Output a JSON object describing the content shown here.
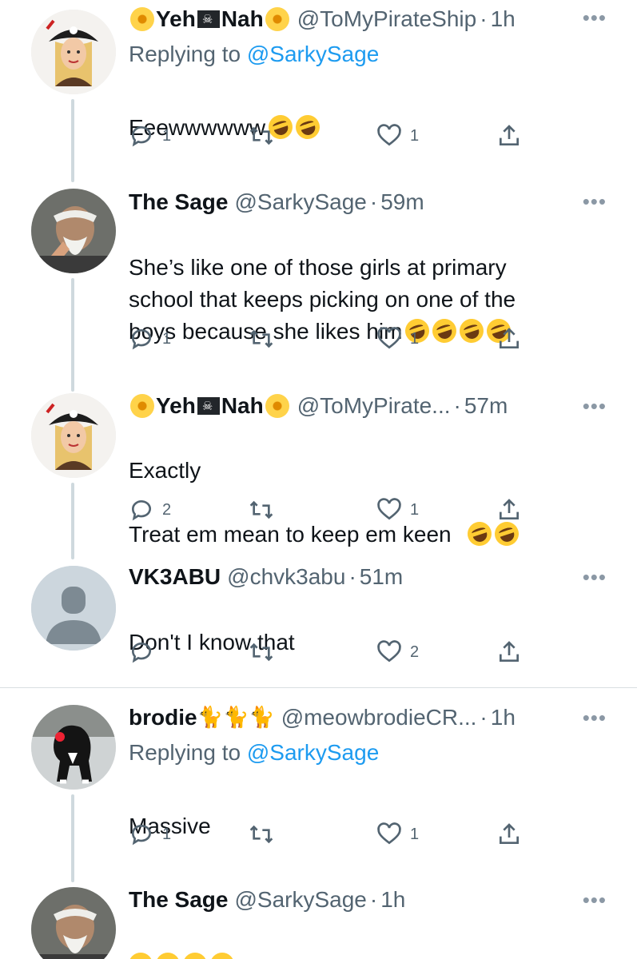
{
  "colors": {
    "text": "#0f1419",
    "muted": "#536471",
    "link": "#1d9bf0",
    "thread_line": "#cfd9de"
  },
  "more_glyph": "•••",
  "tweets": [
    {
      "name_parts": [
        "Yeh",
        "Nah"
      ],
      "handle": "@ToMyPirateShip",
      "time": "1h",
      "replying_label": "Replying to",
      "replying_to": "@SarkySage",
      "text": "Eeewwwwww",
      "emoji": [
        "rolling-on-floor-laughing",
        "rolling-on-floor-laughing"
      ],
      "replies": "1",
      "retweets": "",
      "likes": "1"
    },
    {
      "name": "The Sage",
      "handle": "@SarkySage",
      "time": "59m",
      "text": "She’s like one of those girls at primary\nschool that keeps picking on one of the\nboys because she likes him",
      "emoji": [
        "rolling-on-floor-laughing",
        "rolling-on-floor-laughing",
        "rolling-on-floor-laughing",
        "rolling-on-floor-laughing"
      ],
      "replies": "1",
      "retweets": "",
      "likes": "1"
    },
    {
      "name_parts": [
        "Yeh",
        "Nah"
      ],
      "handle": "@ToMyPirate...",
      "time": "57m",
      "text_line1": "Exactly",
      "text_line2": "Treat em mean to keep em keen",
      "emoji": [
        "rolling-on-floor-laughing",
        "rolling-on-floor-laughing"
      ],
      "replies": "2",
      "retweets": "",
      "likes": "1"
    },
    {
      "name": "VK3ABU",
      "handle": "@chvk3abu",
      "time": "51m",
      "text": "Don't I know that",
      "replies": "",
      "retweets": "",
      "likes": "2"
    },
    {
      "name": "brodie",
      "name_emoji": [
        "black-cat",
        "cat",
        "black-cat"
      ],
      "handle": "@meowbrodieCR...",
      "time": "1h",
      "replying_label": "Replying to",
      "replying_to": "@SarkySage",
      "text": "Massive",
      "replies": "1",
      "retweets": "",
      "likes": "1"
    },
    {
      "name": "The Sage",
      "handle": "@SarkySage",
      "time": "1h",
      "emoji": [
        "face-with-tears-of-joy",
        "face-with-tears-of-joy",
        "face-with-tears-of-joy",
        "face-with-tears-of-joy"
      ]
    }
  ]
}
